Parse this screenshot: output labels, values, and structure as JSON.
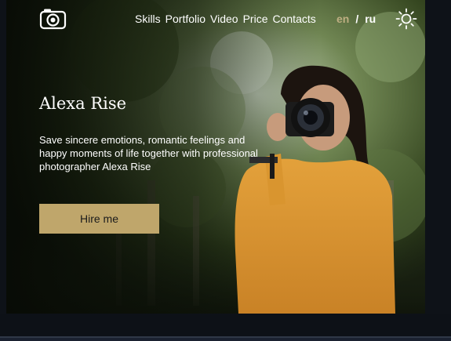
{
  "header": {
    "logo_icon": "camera-icon",
    "nav": [
      "Skills",
      "Portfolio",
      "Video",
      "Price",
      "Contacts"
    ],
    "languages": {
      "en": "en",
      "separator": "/",
      "ru": "ru"
    },
    "active_language": "en",
    "theme_icon": "sun-icon"
  },
  "hero": {
    "title": "Alexa Rise",
    "description": "Save sincere emotions, romantic feelings and happy moments of life together with professional photographer Alexa Rise",
    "button_label": "Hire me"
  },
  "colors": {
    "accent": "#bfa66b",
    "active_language": "#bdae82",
    "text": "#ffffff"
  }
}
